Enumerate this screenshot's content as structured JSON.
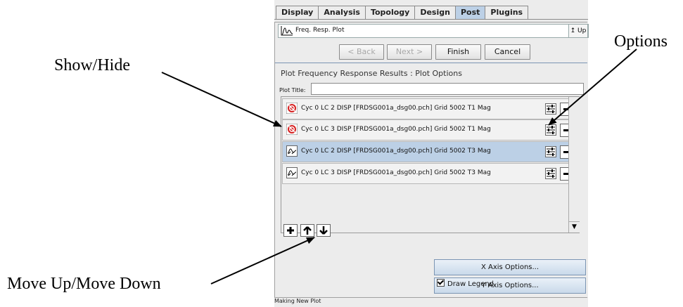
{
  "callouts": {
    "show_hide": "Show/Hide",
    "options": "Options",
    "move": "Move Up/Move Down"
  },
  "tabs": [
    "Display",
    "Analysis",
    "Topology",
    "Design",
    "Post",
    "Plugins"
  ],
  "active_tab": "Post",
  "header": {
    "title": "Freq. Resp. Plot",
    "up_label": "Up"
  },
  "nav": {
    "back": "< Back",
    "next": "Next >",
    "finish": "Finish",
    "cancel": "Cancel"
  },
  "section_title": "Plot Frequency Response Results : Plot Options",
  "plot_title": {
    "label": "Plot Title:",
    "value": ""
  },
  "rows": [
    {
      "label": "Cyc 0 LC 2 DISP [FRDSG001a_dsg00.pch] Grid 5002 T1 Mag",
      "icon": "hidden-icon",
      "selected": false
    },
    {
      "label": "Cyc 0 LC 3 DISP [FRDSG001a_dsg00.pch] Grid 5002 T1 Mag",
      "icon": "hidden-icon",
      "selected": false
    },
    {
      "label": "Cyc 0 LC 2 DISP [FRDSG001a_dsg00.pch] Grid 5002 T3 Mag",
      "icon": "visible-curve-icon",
      "selected": true
    },
    {
      "label": "Cyc 0 LC 3 DISP [FRDSG001a_dsg00.pch] Grid 5002 T3 Mag",
      "icon": "visible-curve-icon",
      "selected": false
    }
  ],
  "axis_buttons": {
    "x": "X Axis Options...",
    "y": "Y Axis Options..."
  },
  "legend": {
    "label": "Draw Legend",
    "checked": true
  },
  "status": "Making New Plot",
  "colors": {
    "selected_row": "#bcd0e6",
    "active_tab": "#bcd0e6",
    "hidden_icon": "#d62020"
  }
}
